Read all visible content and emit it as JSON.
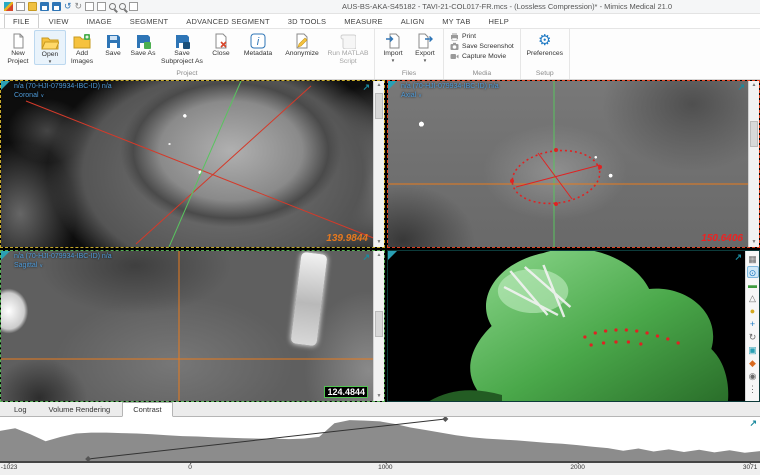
{
  "titlebar": {
    "title": "AUS-BS-AKA-S45182 - TAVI-21-COL017-FR.mcs -  (Lossless Compression)* - Mimics Medical 21.0",
    "quick_access_icons": [
      "materialise-logo",
      "new-document",
      "open-folder",
      "save",
      "save-all",
      "undo",
      "redo",
      "copy",
      "paste",
      "zoom-in",
      "zoom-out",
      "fit-screen"
    ]
  },
  "menu": {
    "tabs": [
      "FILE",
      "VIEW",
      "IMAGE",
      "SEGMENT",
      "ADVANCED SEGMENT",
      "3D TOOLS",
      "MEASURE",
      "ALIGN",
      "MY TAB",
      "HELP"
    ]
  },
  "ribbon": {
    "project": [
      {
        "label": "New Project"
      },
      {
        "label": "Open"
      },
      {
        "label": "Add Images"
      },
      {
        "label": "Save"
      },
      {
        "label": "Save As"
      },
      {
        "label": "Save Subproject As"
      },
      {
        "label": "Close"
      },
      {
        "label": "Metadata"
      },
      {
        "label": "Anonymize"
      },
      {
        "label": "Run MATLAB Script"
      }
    ],
    "files": [
      {
        "label": "Import"
      },
      {
        "label": "Export"
      }
    ],
    "media": [
      {
        "label": "Print"
      },
      {
        "label": "Save Screenshot"
      },
      {
        "label": "Capture Movie"
      }
    ],
    "setup": [
      {
        "label": "Preferences"
      }
    ],
    "group_labels": {
      "project": "Project",
      "files": "Files",
      "media": "Media",
      "setup": "Setup"
    }
  },
  "viewports": {
    "coronal": {
      "patient": "n/a (70-HJI-079934-IBC-ID) n/a",
      "orientation": "Coronal",
      "slice_value": "139.9844"
    },
    "axial": {
      "patient": "n/a (70-HJI-079934-IBC-ID) n/a",
      "orientation": "Axial",
      "slice_value": "150.6406"
    },
    "sagittal": {
      "patient": "n/a (70-HJI-079934-IBC-ID) n/a",
      "orientation": "Sagittal",
      "slice_value": "124.4844"
    },
    "three_d": {
      "toolbar_icons": [
        "layout-grid",
        "zoom",
        "clip-plane",
        "mesh-triangle",
        "sphere-marker",
        "pan",
        "rotate",
        "cube-view",
        "point-marker",
        "visibility",
        "more"
      ]
    }
  },
  "panel_tabs": [
    "Log",
    "Volume Rendering",
    "Contrast"
  ],
  "contrast": {
    "xticks": [
      {
        "label": "-1023",
        "pos": 1.2
      },
      {
        "label": "0",
        "pos": 25.0
      },
      {
        "label": "1000",
        "pos": 50.7
      },
      {
        "label": "2000",
        "pos": 76.0
      },
      {
        "label": "3071",
        "pos": 98.7
      }
    ],
    "samples": [
      0.7,
      0.76,
      0.62,
      0.46,
      0.56,
      0.64,
      0.66,
      0.66,
      0.65,
      0.64,
      0.62,
      0.6,
      0.58,
      0.57,
      0.55,
      0.54,
      0.53,
      0.52,
      0.52,
      0.51,
      0.52,
      0.56,
      0.88,
      0.95,
      0.94,
      0.92,
      0.86,
      0.78,
      0.72,
      0.66,
      0.6,
      0.55,
      0.52,
      0.5,
      0.48,
      0.45,
      0.42,
      0.4,
      0.37,
      0.33,
      0.3,
      0.24,
      0.29,
      0.22,
      0.27,
      0.21,
      0.26,
      0.2,
      0.25,
      0.19,
      0.23
    ],
    "line": {
      "x1_pct": 11.6,
      "x2_pct": 58.6
    }
  },
  "icons": {
    "expand": "↗",
    "gear": "⚙",
    "caret_down": "∨",
    "dropdown": "▼",
    "scroll_up": "▲",
    "scroll_down": "▼",
    "undo": "↺",
    "redo": "↻",
    "toolbar3d": [
      "▦",
      "⊙",
      "▬",
      "△",
      "●",
      "+",
      "↻",
      "▣",
      "◆",
      "◉",
      "⋮"
    ]
  },
  "colors": {
    "accent_teal": "#2aa0b4",
    "overlay_text": "#4f9bd9",
    "coronal_border": "#c7aa2a",
    "axial_border": "#e0401e",
    "sagittal_border": "#57b157",
    "coronal_value": "#e8791e",
    "axial_value": "#ee2222",
    "model_green": "#3f9b3f"
  }
}
